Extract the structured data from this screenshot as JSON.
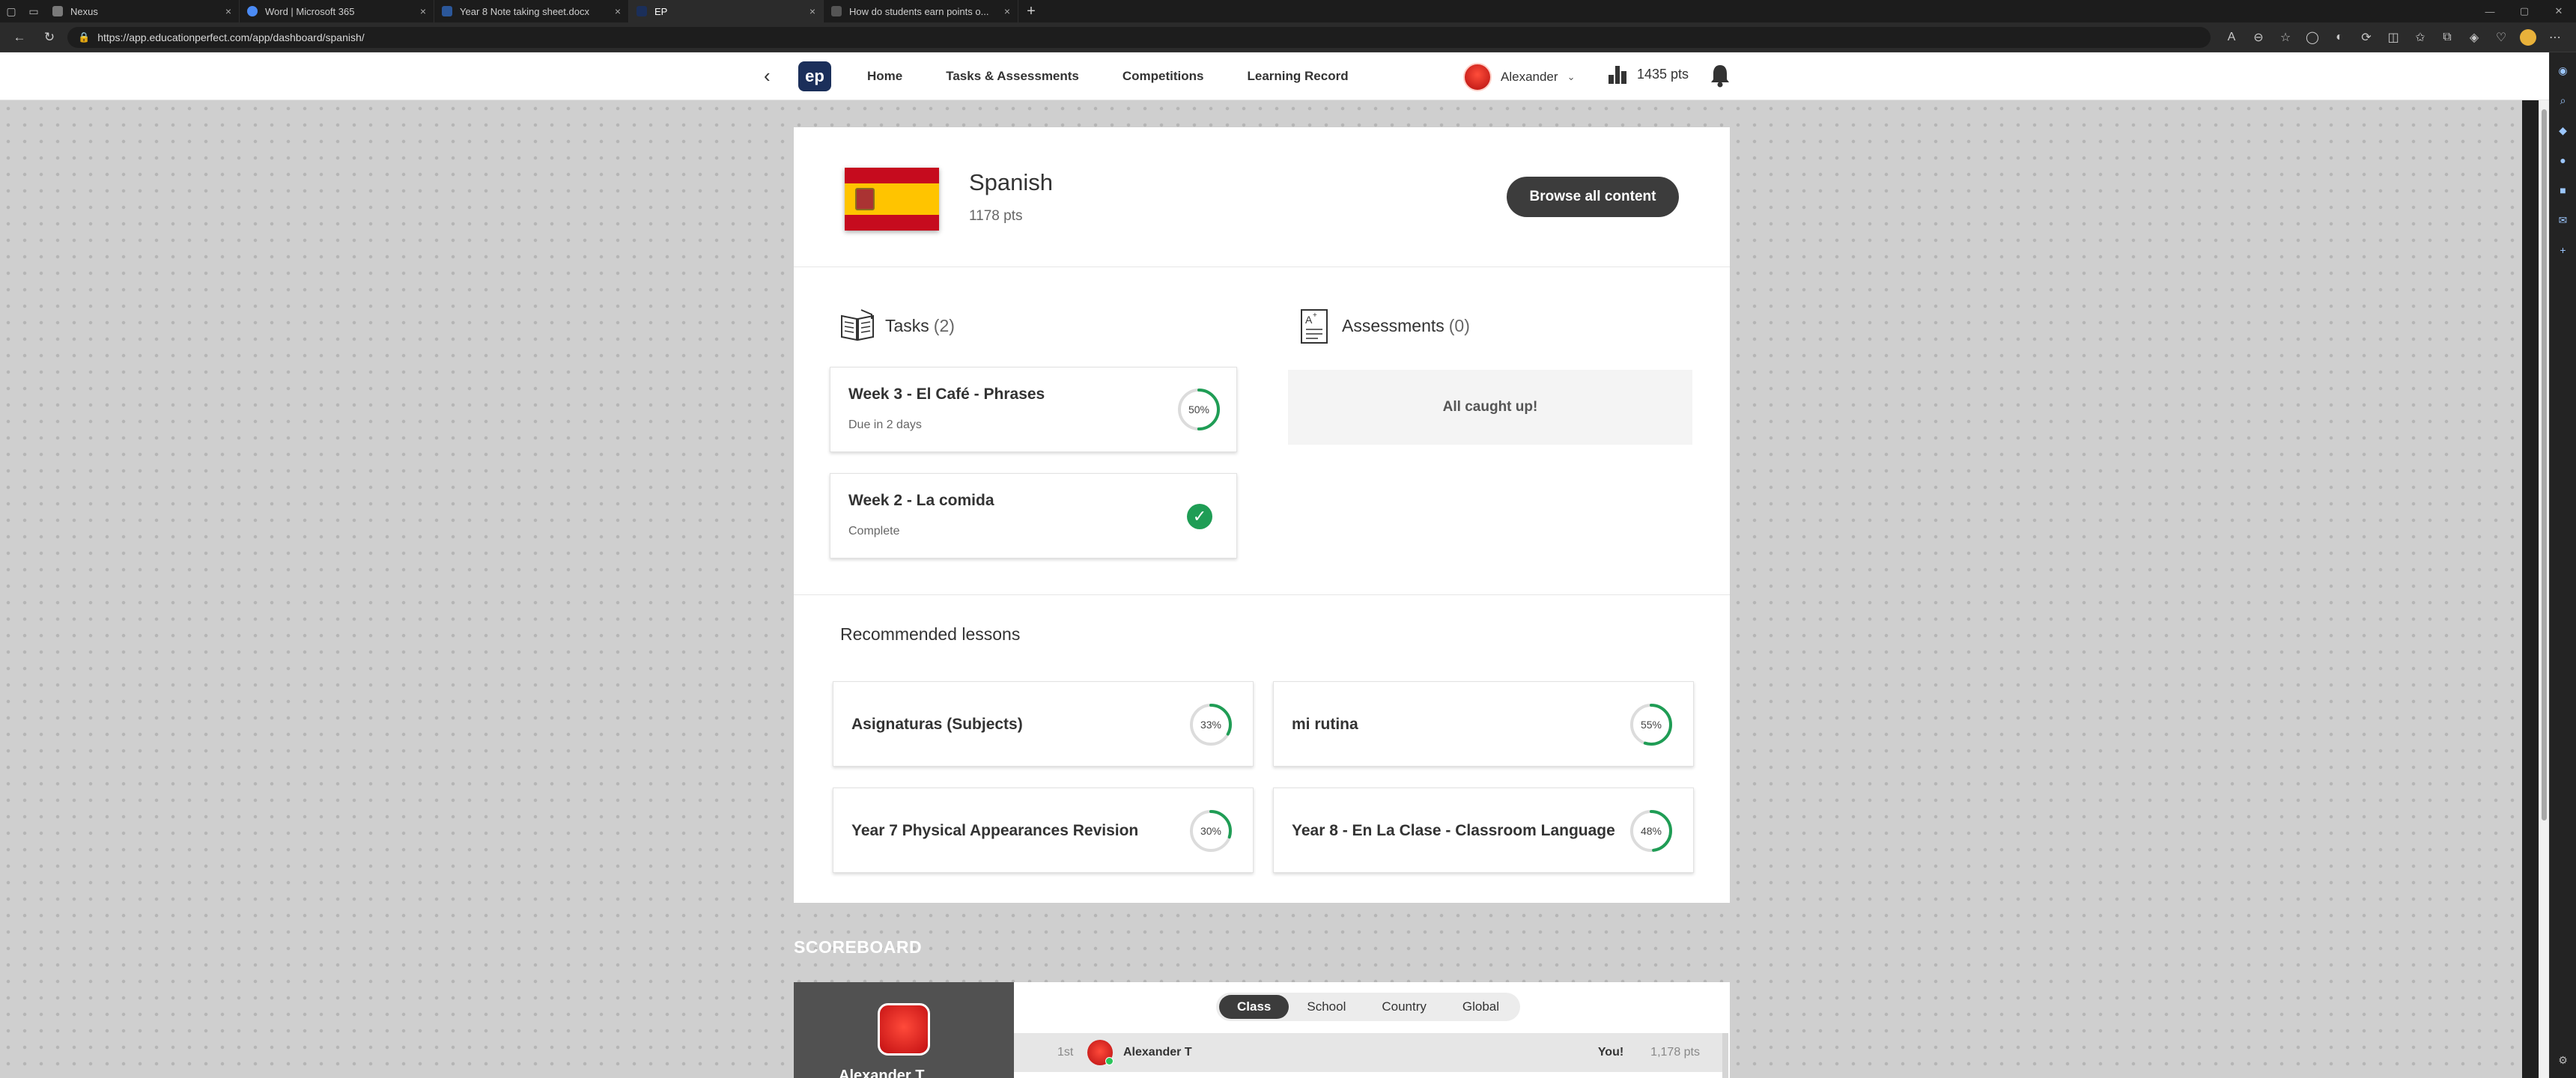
{
  "browser": {
    "tabs": [
      {
        "label": "Nexus",
        "color": "#7a7a7a"
      },
      {
        "label": "Word | Microsoft 365",
        "color": "#4b8bf5"
      },
      {
        "label": "Year 8 Note taking sheet.docx",
        "color": "#2b579a"
      },
      {
        "label": "EP",
        "color": "#1b2f5a"
      },
      {
        "label": "How do students earn points o...",
        "color": "#555555"
      }
    ],
    "url": "https://app.educationperfect.com/app/dashboard/spanish/"
  },
  "header": {
    "logo": "ep",
    "nav": [
      "Home",
      "Tasks & Assessments",
      "Competitions",
      "Learning Record"
    ],
    "user_name": "Alexander",
    "points": "1435 pts"
  },
  "course": {
    "name": "Spanish",
    "points": "1178 pts",
    "browse_label": "Browse all content"
  },
  "tasks": {
    "label": "Tasks",
    "count": "(2)",
    "items": [
      {
        "title": "Week 3 - El Café - Phrases",
        "status": "Due in 2 days",
        "progress": 50,
        "progress_label": "50%"
      },
      {
        "title": "Week 2 - La comida",
        "status": "Complete"
      }
    ]
  },
  "assessments": {
    "label": "Assessments",
    "count": "(0)",
    "empty_message": "All caught up!"
  },
  "recommended": {
    "label": "Recommended lessons",
    "items": [
      {
        "title": "Asignaturas (Subjects)",
        "progress": 33,
        "progress_label": "33%"
      },
      {
        "title": "mi rutina",
        "progress": 55,
        "progress_label": "55%"
      },
      {
        "title": "Year 7 Physical Appearances Revision",
        "progress": 30,
        "progress_label": "30%"
      },
      {
        "title": "Year 8 - En La Clase - Classroom Language",
        "progress": 48,
        "progress_label": "48%"
      }
    ]
  },
  "scoreboard": {
    "title": "SCOREBOARD",
    "tabs": [
      "Class",
      "School",
      "Country",
      "Global"
    ],
    "active_tab": "Class",
    "profile_name": "Alexander T",
    "rows": [
      {
        "rank": "1st",
        "name": "Alexander T",
        "tag": "You!",
        "points": "1,178 pts"
      }
    ]
  },
  "colors": {
    "accent": "#3c3c3c",
    "progress": "#1f9d55",
    "brand": "#1b2f5a"
  }
}
